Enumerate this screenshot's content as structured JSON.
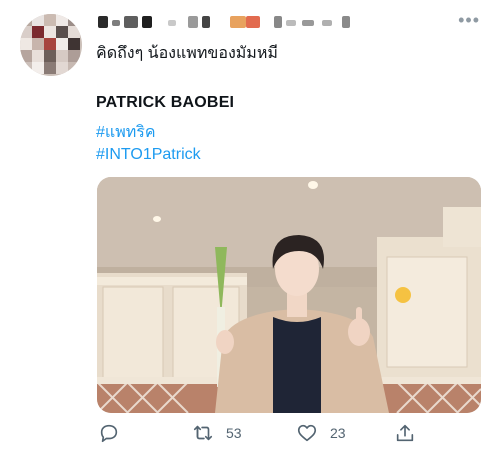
{
  "tweet": {
    "text": "คิดถึงๆ น้องแพทของมัมหมี",
    "title": "PATRICK BAOBEI",
    "hashtags": [
      "#แพทริค",
      "#INTO1Patrick"
    ],
    "more_icon": "more-icon"
  },
  "actions": {
    "reply": {
      "icon": "reply-icon"
    },
    "retweet": {
      "icon": "retweet-icon",
      "count": "53"
    },
    "like": {
      "icon": "heart-icon",
      "count": "23"
    },
    "share": {
      "icon": "share-icon"
    }
  },
  "colors": {
    "link": "#1d9bf0",
    "muted": "#536471"
  }
}
